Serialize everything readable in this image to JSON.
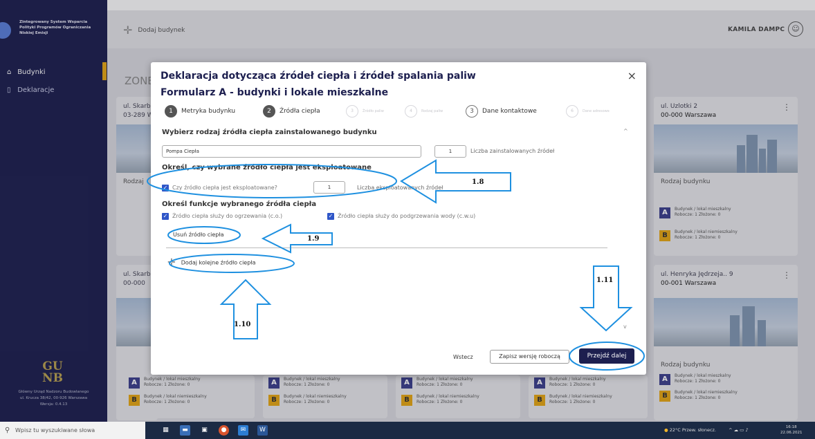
{
  "sidebar": {
    "title": "Zintegrowany System Wsparcia Polityki Programów Ograniczania Niskiej Emisji",
    "items": [
      {
        "label": "Budynki"
      },
      {
        "label": "Deklaracje"
      }
    ],
    "logo_text": "GU NB",
    "footer": [
      "Główny Urząd Nadzoru Budowlanego",
      "ul. Krucza 38/42, 00-926 Warszawa",
      "Wersja: 0.4.13"
    ]
  },
  "header": {
    "add_building": "Dodaj budynek",
    "user_name": "KAMILA DAMPC",
    "zone": "ZONE"
  },
  "cards": [
    {
      "addr1": "ul. Skarb",
      "addr2": "03-289 W"
    },
    {
      "addr1": "ul. Uzlotki 2",
      "addr2": "00-000 Warszawa"
    },
    {
      "addr1": "ul. Skarb",
      "addr2": "00-000"
    },
    {
      "addr1": "ul. Henryka Jędrzeja.. 9",
      "addr2": "00-001 Warszawa"
    }
  ],
  "card_text": {
    "rodzaj": "Rodzaj",
    "rodzaj_full": "Rodzaj budynku",
    "a_title": "Budynek / lokal mieszkalny",
    "a_sub": "Robocze: 1   Złożone: 0",
    "b_title": "Budynek / lokal niemieszkalny",
    "b_sub": "Robocze: 1   Złożone: 0"
  },
  "modal": {
    "title1": "Deklaracja dotycząca źródeł ciepła i źródeł spalania paliw",
    "title2": "Formularz A - budynki i lokale mieszkalne",
    "steps": [
      {
        "num": "1",
        "label": "Metryka budynku"
      },
      {
        "num": "2",
        "label": "Źródła ciepła"
      },
      {
        "num": "3",
        "label": "Źródło paliw"
      },
      {
        "num": "4",
        "label": "Rodzaj paliw"
      },
      {
        "num": "3",
        "label": "Dane kontaktowe"
      },
      {
        "num": "6",
        "label": "Dane adresowe"
      }
    ],
    "section1": "Wybierz rodzaj źródła ciepła zainstalowanego budynku",
    "source_value": "Pompa Ciepła",
    "count_value": "1",
    "count_label": "Liczba zainstalowanych źródeł",
    "section2": "Określ, czy wybrane źródło ciepła jest eksploatowane",
    "cb_operated": "Czy źródło ciepła jest eksploatowane?",
    "operated_count": "1",
    "operated_label": "Liczba eksploatowanych źródeł",
    "section3": "Określ funkcje wybranego źródła ciepła",
    "cb_heating": "Źródło ciepła służy do ogrzewania (c.o.)",
    "cb_water": "Źródło ciepła służy do podgrzewania wody (c.w.u)",
    "remove": "Usuń źródło ciepła",
    "add_next": "Dodaj kolejne źródło ciepła",
    "back": "Wstecz",
    "draft": "Zapisz wersję roboczą",
    "next": "Przejdź dalej",
    "close": "×"
  },
  "annotations": [
    "1.8",
    "1.9",
    "1.10",
    "1.11"
  ],
  "taskbar": {
    "search_placeholder": "Wpisz tu wyszukiwane słowa",
    "weather": "22°C  Przew. słonecz.",
    "time": "16:18",
    "date": "22.06.2021"
  },
  "colors": {
    "navy": "#1d1f4f",
    "accent": "#e3a514",
    "annotation": "#1e90e0",
    "checkbox": "#2f56c8"
  }
}
